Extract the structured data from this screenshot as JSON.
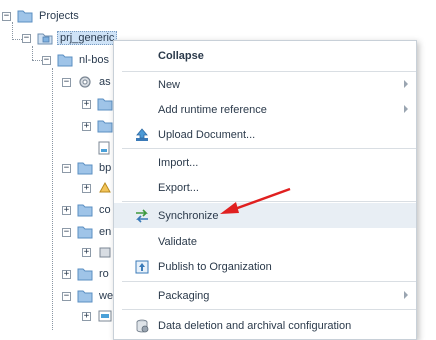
{
  "tree": {
    "root": {
      "label": "Projects",
      "icon": "folder-icon"
    },
    "project": {
      "label": "prj_generic",
      "icon": "project-icon",
      "selected": true
    },
    "level2": {
      "label": "nl-bos",
      "icon": "folder-icon"
    },
    "children": [
      {
        "label": "as",
        "icon": "gear-icon"
      },
      {
        "label": "bp",
        "icon": "folder-icon"
      },
      {
        "label": "co",
        "icon": "folder-icon"
      },
      {
        "label": "en",
        "icon": "folder-icon"
      },
      {
        "label": "ro",
        "icon": "folder-icon"
      },
      {
        "label": "we",
        "icon": "folder-icon"
      }
    ]
  },
  "context_menu": {
    "items": [
      {
        "label": "Collapse",
        "bold": true,
        "icon": "",
        "submenu": false
      },
      {
        "label": "New",
        "icon": "",
        "submenu": true
      },
      {
        "label": "Add runtime reference",
        "icon": "",
        "submenu": true
      },
      {
        "label": "Upload Document...",
        "icon": "upload-icon",
        "submenu": false
      },
      {
        "label": "Import...",
        "icon": "",
        "submenu": false
      },
      {
        "label": "Export...",
        "icon": "",
        "submenu": false
      },
      {
        "label": "Synchronize",
        "icon": "synchronize-icon",
        "submenu": false,
        "highlighted": true
      },
      {
        "label": "Validate",
        "icon": "",
        "submenu": false
      },
      {
        "label": "Publish to Organization",
        "icon": "publish-icon",
        "submenu": false
      },
      {
        "label": "Packaging",
        "icon": "",
        "submenu": true
      },
      {
        "label": "Data deletion and archival configuration",
        "icon": "data-config-icon",
        "submenu": false
      }
    ]
  },
  "annotation": {
    "arrow_color": "#e02020"
  }
}
